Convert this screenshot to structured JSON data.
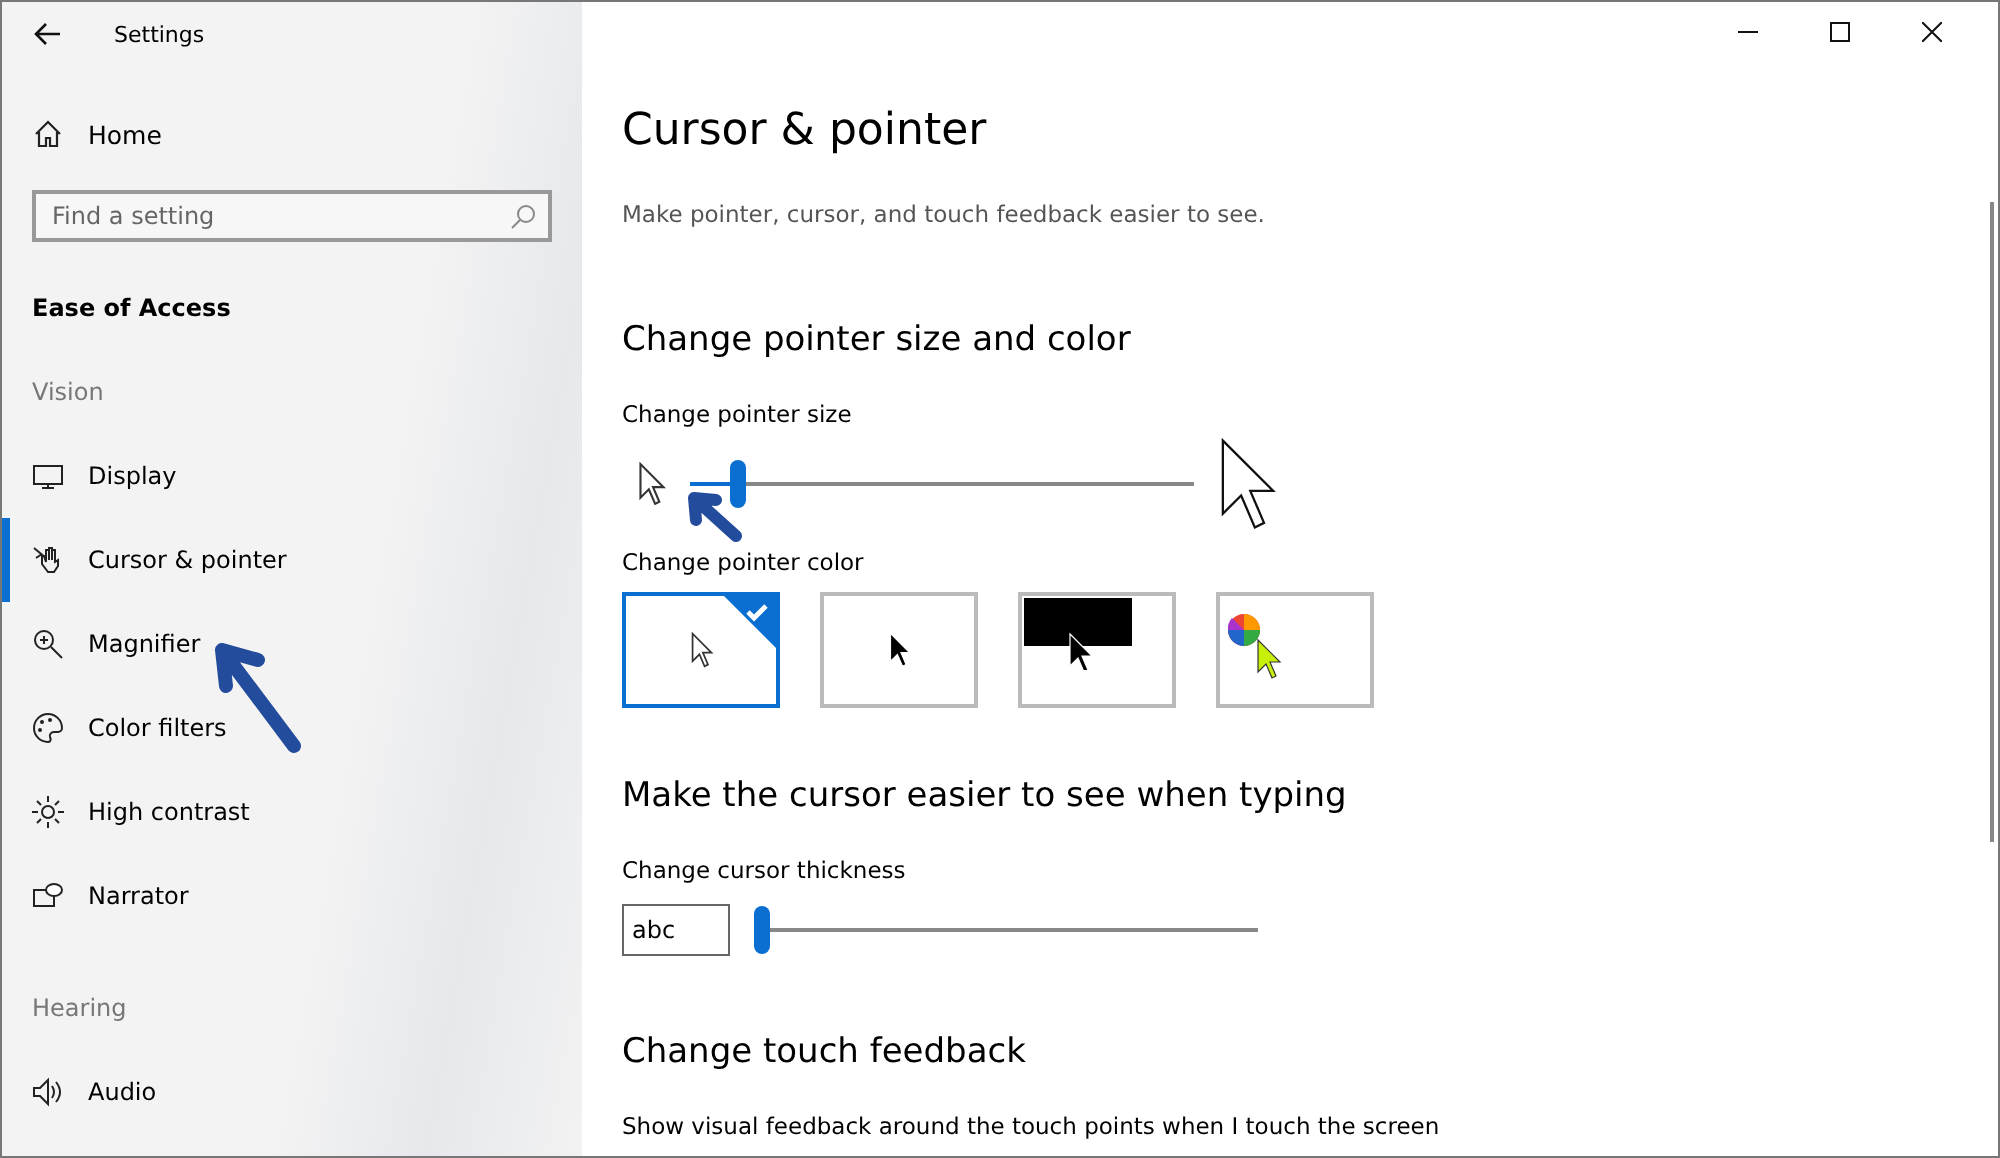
{
  "window": {
    "title": "Settings"
  },
  "sidebar": {
    "home": "Home",
    "search": {
      "placeholder": "Find a setting"
    },
    "section_title": "Ease of Access",
    "groups": [
      {
        "heading": "Vision",
        "items": [
          {
            "label": "Display",
            "kind": "display",
            "selected": false
          },
          {
            "label": "Cursor & pointer",
            "kind": "cursor",
            "selected": true
          },
          {
            "label": "Magnifier",
            "kind": "magnifier",
            "selected": false
          },
          {
            "label": "Color filters",
            "kind": "palette",
            "selected": false
          },
          {
            "label": "High contrast",
            "kind": "sun",
            "selected": false
          },
          {
            "label": "Narrator",
            "kind": "narrator",
            "selected": false
          }
        ]
      },
      {
        "heading": "Hearing",
        "items": [
          {
            "label": "Audio",
            "kind": "speaker",
            "selected": false
          }
        ]
      }
    ]
  },
  "page": {
    "title": "Cursor & pointer",
    "subtitle": "Make pointer, cursor, and touch feedback easier to see.",
    "pointer": {
      "heading": "Change pointer size and color",
      "size_label": "Change pointer size",
      "size": {
        "level": 0.08
      },
      "color_label": "Change pointer color",
      "colors": [
        {
          "kind": "white",
          "selected": true
        },
        {
          "kind": "black",
          "selected": false
        },
        {
          "kind": "inverted",
          "selected": false
        },
        {
          "kind": "custom",
          "selected": false
        }
      ]
    },
    "typing": {
      "heading": "Make the cursor easier to see when typing",
      "thickness_label": "Change cursor thickness",
      "preview": "abc",
      "thickness": {
        "level": 0
      }
    },
    "touch": {
      "heading": "Change touch feedback",
      "description": "Show visual feedback around the touch points when I touch the screen"
    }
  }
}
